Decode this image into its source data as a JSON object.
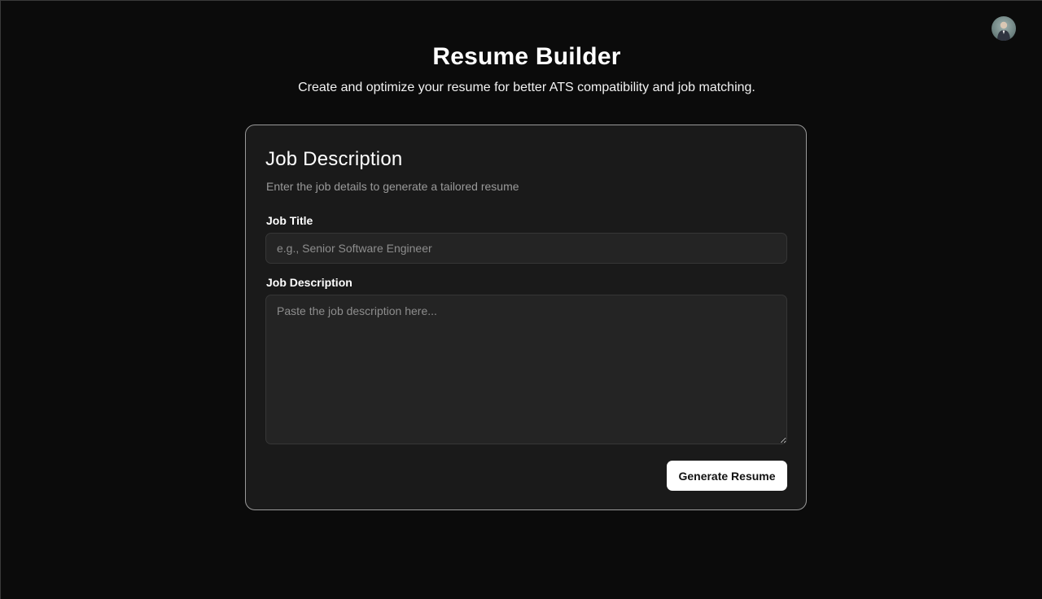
{
  "header": {
    "title": "Resume Builder",
    "subtitle": "Create and optimize your resume for better ATS compatibility and job matching."
  },
  "user": {
    "avatar_icon": "user-avatar"
  },
  "card": {
    "title": "Job Description",
    "description": "Enter the job details to generate a tailored resume",
    "job_title": {
      "label": "Job Title",
      "value": "",
      "placeholder": "e.g., Senior Software Engineer"
    },
    "job_description": {
      "label": "Job Description",
      "value": "",
      "placeholder": "Paste the job description here..."
    },
    "generate_label": "Generate Resume"
  },
  "colors": {
    "background": "#0b0b0b",
    "card_background": "#1a1a1a",
    "card_border": "#9a9a9a",
    "input_background": "#242424",
    "button_background": "#ffffff",
    "button_text": "#111111",
    "muted_text": "#9a9a9a"
  }
}
